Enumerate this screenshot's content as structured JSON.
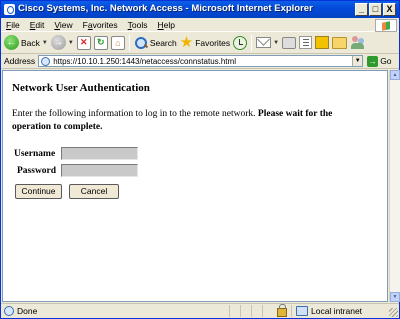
{
  "window": {
    "title": "Cisco Systems, Inc. Network Access - Microsoft Internet Explorer",
    "controls": {
      "minimize": "_",
      "maximize": "□",
      "close": "X"
    }
  },
  "menu": {
    "items": [
      {
        "underline": "F",
        "rest": "ile"
      },
      {
        "underline": "E",
        "rest": "dit"
      },
      {
        "underline": "V",
        "rest": "iew"
      },
      {
        "pre": "F",
        "underline": "a",
        "rest": "vorites"
      },
      {
        "underline": "T",
        "rest": "ools"
      },
      {
        "underline": "H",
        "rest": "elp"
      }
    ]
  },
  "toolbar": {
    "back_label": "Back",
    "search_label": "Search",
    "favorites_label": "Favorites"
  },
  "address": {
    "label": "Address",
    "url": "https://10.10.1.250:1443/netaccess/connstatus.html",
    "go_label": "Go"
  },
  "content": {
    "title": "Network User Authentication",
    "instruction": "Enter the following information to log in to the remote network.",
    "instruction_bold": "Please wait for the operation to complete.",
    "form": {
      "username_label": "Username",
      "password_label": "Password",
      "username_value": "",
      "password_value": "",
      "continue_label": "Continue",
      "cancel_label": "Cancel"
    }
  },
  "status": {
    "text": "Done",
    "zone": "Local intranet"
  }
}
